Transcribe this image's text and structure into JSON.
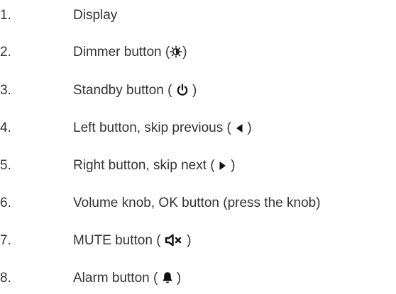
{
  "items": [
    {
      "number": "1.",
      "text": "Display"
    },
    {
      "number": "2.",
      "text_before": "Dimmer button (",
      "icon": "dimmer-icon",
      "text_after": ")"
    },
    {
      "number": "3.",
      "text_before": "Standby button  ( ",
      "icon": "power-icon",
      "text_after": " )"
    },
    {
      "number": "4.",
      "text_before": "Left button, skip previous ( ",
      "icon": "triangle-left-icon",
      "text_after": " )"
    },
    {
      "number": "5.",
      "text_before": "Right button, skip next ( ",
      "icon": "triangle-right-icon",
      "text_after": " )"
    },
    {
      "number": "6.",
      "text": "Volume knob, OK button (press the knob)"
    },
    {
      "number": "7.",
      "text_before": "MUTE button ( ",
      "icon": "speaker-mute-icon",
      "text_after": " )"
    },
    {
      "number": "8.",
      "text_before": "Alarm button  ( ",
      "icon": "bell-icon",
      "text_after": " )"
    }
  ]
}
